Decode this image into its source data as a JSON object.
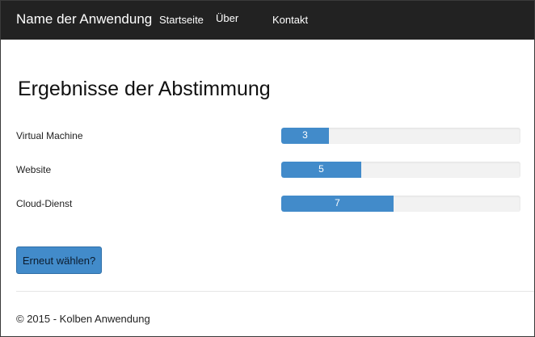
{
  "navbar": {
    "brand": "Name der Anwendung",
    "links": [
      "Startseite",
      "Über",
      "Kontakt"
    ]
  },
  "main": {
    "title": "Ergebnisse der Abstimmung",
    "results": [
      {
        "label": "Virtual Machine",
        "votes": "3",
        "fill_fraction": 0.2
      },
      {
        "label": "Website",
        "votes": "5",
        "fill_fraction": 0.335
      },
      {
        "label": "Cloud-Dienst",
        "votes": "7",
        "fill_fraction": 0.47
      }
    ],
    "vote_again_button": "Erneut wählen?"
  },
  "footer": {
    "text": "© 2015 - Kolben Anwendung"
  },
  "colors": {
    "navbar_background": "#222222",
    "accent": "#428bca",
    "progress_track": "#f2f2f2"
  }
}
